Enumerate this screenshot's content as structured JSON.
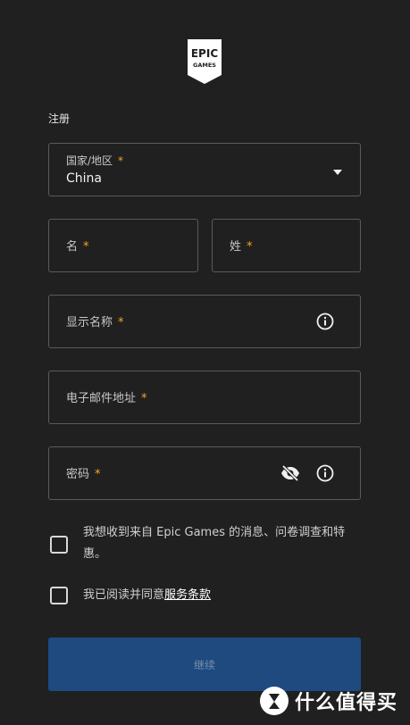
{
  "brand": {
    "logo_line1": "EPIC",
    "logo_line2": "GAMES"
  },
  "form": {
    "title": "注册",
    "required_mark": "*",
    "country": {
      "label": "国家/地区",
      "value": "China"
    },
    "first_name": {
      "label": "名"
    },
    "last_name": {
      "label": "姓"
    },
    "display_name": {
      "label": "显示名称",
      "icon": "info-icon"
    },
    "email": {
      "label": "电子邮件地址"
    },
    "password": {
      "label": "密码",
      "icons": [
        "eye-off-icon",
        "info-icon"
      ]
    },
    "marketing_opt_in": {
      "text": "我想收到来自 Epic Games 的消息、问卷调查和特惠。",
      "checked": false
    },
    "terms": {
      "text_prefix": "我已阅读并同意",
      "link": "服务条款",
      "checked": false
    },
    "continue_label": "继续"
  },
  "watermark": {
    "text": "什么值得买",
    "icon": "smzdm-logo-icon"
  },
  "colors": {
    "background": "#202020",
    "border": "#5a5a5a",
    "required": "#f6a524",
    "button": "#1e4a80"
  }
}
